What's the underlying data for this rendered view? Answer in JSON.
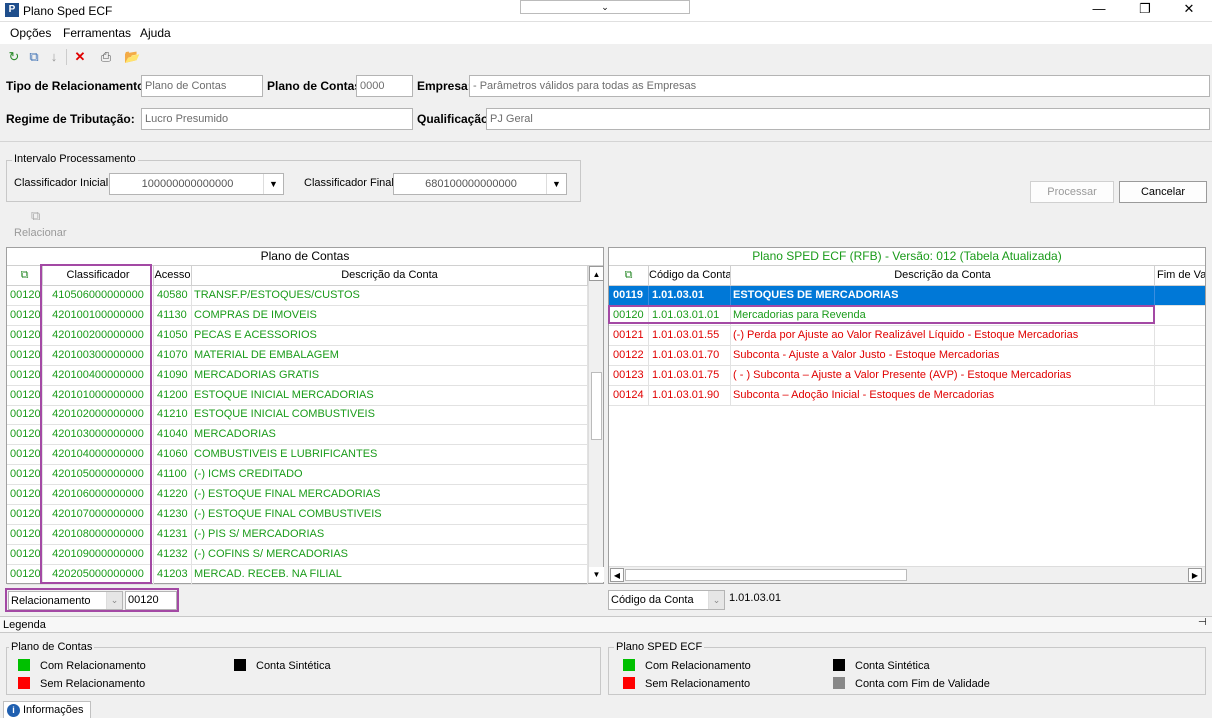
{
  "window": {
    "title": "Plano Sped ECF",
    "app_icon": "P",
    "min": "—",
    "max": "❐",
    "close": "✕"
  },
  "menu": [
    "Opções",
    "Ferramentas",
    "Ajuda"
  ],
  "header": {
    "tipo_label": "Tipo de Relacionamento:",
    "tipo_value": "Plano de Contas",
    "plano_label": "Plano de Contas:",
    "plano_value": "0000",
    "empresa_label": "Empresa:",
    "empresa_value": "- Parâmetros válidos para todas as Empresas",
    "regime_label": "Regime de Tributação:",
    "regime_value": "Lucro Presumido",
    "qualificacao_label": "Qualificação:",
    "qualificacao_value": "PJ Geral"
  },
  "intervalo": {
    "title": "Intervalo Processamento",
    "inicial_label": "Classificador Inicial:",
    "inicial_value": "100000000000000",
    "final_label": "Classificador Final:",
    "final_value": "680100000000000"
  },
  "buttons": {
    "processar": "Processar",
    "cancelar": "Cancelar",
    "relacionar": "Relacionar"
  },
  "left_grid": {
    "title": "Plano de Contas",
    "columns": [
      "Classificador",
      "Acesso",
      "Descrição da Conta"
    ],
    "rows": [
      {
        "rel": "00120",
        "cls": "410506000000000",
        "acesso": "40580",
        "desc": "TRANSF.P/ESTOQUES/CUSTOS"
      },
      {
        "rel": "00120",
        "cls": "420100100000000",
        "acesso": "41130",
        "desc": "COMPRAS DE IMOVEIS"
      },
      {
        "rel": "00120",
        "cls": "420100200000000",
        "acesso": "41050",
        "desc": "PECAS E ACESSORIOS"
      },
      {
        "rel": "00120",
        "cls": "420100300000000",
        "acesso": "41070",
        "desc": "MATERIAL DE EMBALAGEM"
      },
      {
        "rel": "00120",
        "cls": "420100400000000",
        "acesso": "41090",
        "desc": "MERCADORIAS GRATIS"
      },
      {
        "rel": "00120",
        "cls": "420101000000000",
        "acesso": "41200",
        "desc": "ESTOQUE INICIAL MERCADORIAS"
      },
      {
        "rel": "00120",
        "cls": "420102000000000",
        "acesso": "41210",
        "desc": "ESTOQUE INICIAL COMBUSTIVEIS"
      },
      {
        "rel": "00120",
        "cls": "420103000000000",
        "acesso": "41040",
        "desc": "MERCADORIAS"
      },
      {
        "rel": "00120",
        "cls": "420104000000000",
        "acesso": "41060",
        "desc": "COMBUSTIVEIS E LUBRIFICANTES"
      },
      {
        "rel": "00120",
        "cls": "420105000000000",
        "acesso": "41100",
        "desc": "(-) ICMS CREDITADO"
      },
      {
        "rel": "00120",
        "cls": "420106000000000",
        "acesso": "41220",
        "desc": "(-) ESTOQUE FINAL MERCADORIAS"
      },
      {
        "rel": "00120",
        "cls": "420107000000000",
        "acesso": "41230",
        "desc": "(-) ESTOQUE FINAL COMBUSTIVEIS"
      },
      {
        "rel": "00120",
        "cls": "420108000000000",
        "acesso": "41231",
        "desc": "(-) PIS S/ MERCADORIAS"
      },
      {
        "rel": "00120",
        "cls": "420109000000000",
        "acesso": "41232",
        "desc": "(-) COFINS S/ MERCADORIAS"
      },
      {
        "rel": "00120",
        "cls": "420205000000000",
        "acesso": "41203",
        "desc": "MERCAD. RECEB. NA FILIAL"
      }
    ],
    "filter_label": "Relacionamento",
    "filter_value": "00120"
  },
  "right_grid": {
    "title": "Plano SPED ECF (RFB) - Versão: 012 (Tabela Atualizada)",
    "columns": [
      "Código da Conta",
      "Descrição da Conta",
      "Fim de Vali"
    ],
    "rows": [
      {
        "id": "00119",
        "code": "1.01.03.01",
        "desc": "ESTOQUES DE MERCADORIAS"
      },
      {
        "id": "00120",
        "code": "1.01.03.01.01",
        "desc": "Mercadorias para Revenda"
      },
      {
        "id": "00121",
        "code": "1.01.03.01.55",
        "desc": "(-) Perda por Ajuste ao Valor Realizável Líquido - Estoque Mercadorias"
      },
      {
        "id": "00122",
        "code": "1.01.03.01.70",
        "desc": "Subconta - Ajuste a Valor Justo - Estoque Mercadorias"
      },
      {
        "id": "00123",
        "code": "1.01.03.01.75",
        "desc": "( - ) Subconta – Ajuste a Valor Presente (AVP) -  Estoque Mercadorias"
      },
      {
        "id": "00124",
        "code": "1.01.03.01.90",
        "desc": "Subconta – Adoção Inicial -  Estoques de Mercadorias"
      }
    ],
    "filter_label": "Código da Conta",
    "filter_value": "1.01.03.01"
  },
  "legenda": {
    "title": "Legenda",
    "left_title": "Plano de Contas",
    "right_title": "Plano SPED ECF",
    "com": "Com Relacionamento",
    "sem": "Sem Relacionamento",
    "sintetica": "Conta Sintética",
    "fim": "Conta com Fim de Validade",
    "colors": {
      "com": "#00c000",
      "sem": "#ff0000",
      "sintetica": "#000000",
      "fim": "#888888"
    }
  },
  "status": {
    "informacoes": "Informações"
  }
}
